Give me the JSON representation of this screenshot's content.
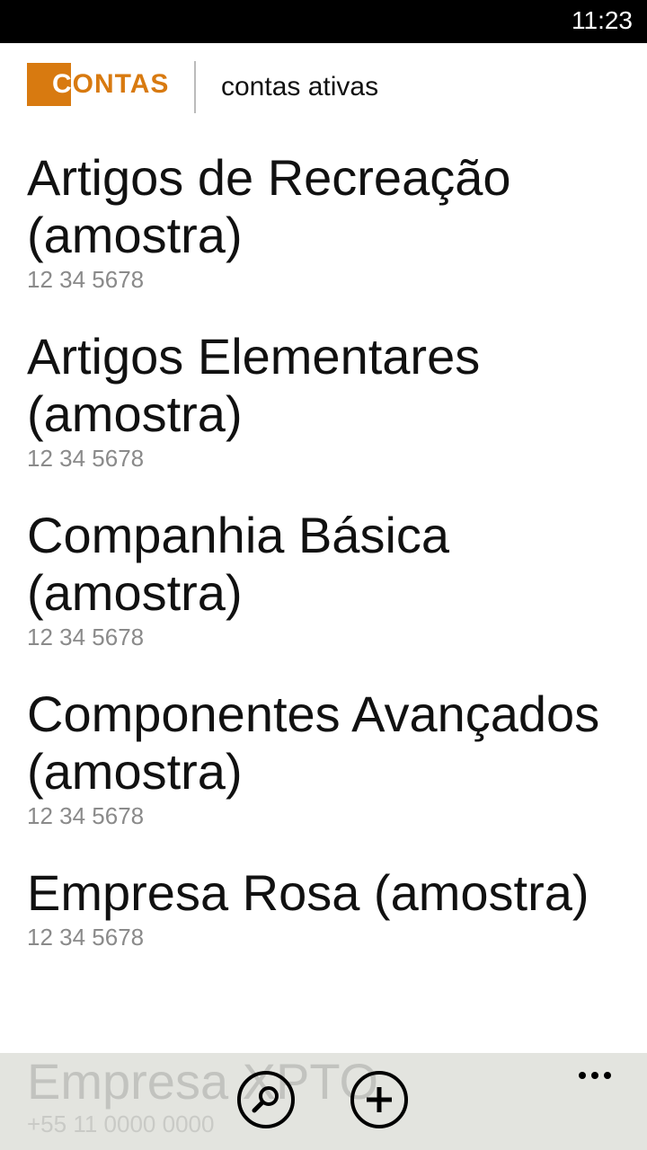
{
  "status_bar": {
    "time": "11:23"
  },
  "header": {
    "logo_first_letter": "C",
    "logo_rest": "ONTAS",
    "subtitle": "contas ativas"
  },
  "accounts": [
    {
      "name": "Artigos de Recreação (amostra)",
      "phone": "12 34 5678"
    },
    {
      "name": "Artigos Elementares (amostra)",
      "phone": "12 34 5678"
    },
    {
      "name": "Companhia Básica (amostra)",
      "phone": "12 34 5678"
    },
    {
      "name": "Componentes Avançados (amostra)",
      "phone": "12 34 5678"
    },
    {
      "name": "Empresa Rosa (amostra)",
      "phone": "12 34 5678"
    },
    {
      "name": "Empresa XPTO",
      "phone": "+55 11 0000 0000"
    }
  ],
  "app_bar": {
    "buttons": [
      {
        "icon": "search-icon"
      },
      {
        "icon": "add-icon"
      }
    ],
    "more_icon": "ellipsis-icon"
  },
  "colors": {
    "accent": "#d87a10",
    "app_bar_bg": "#e3e4df",
    "status_bar_bg": "#000000"
  }
}
